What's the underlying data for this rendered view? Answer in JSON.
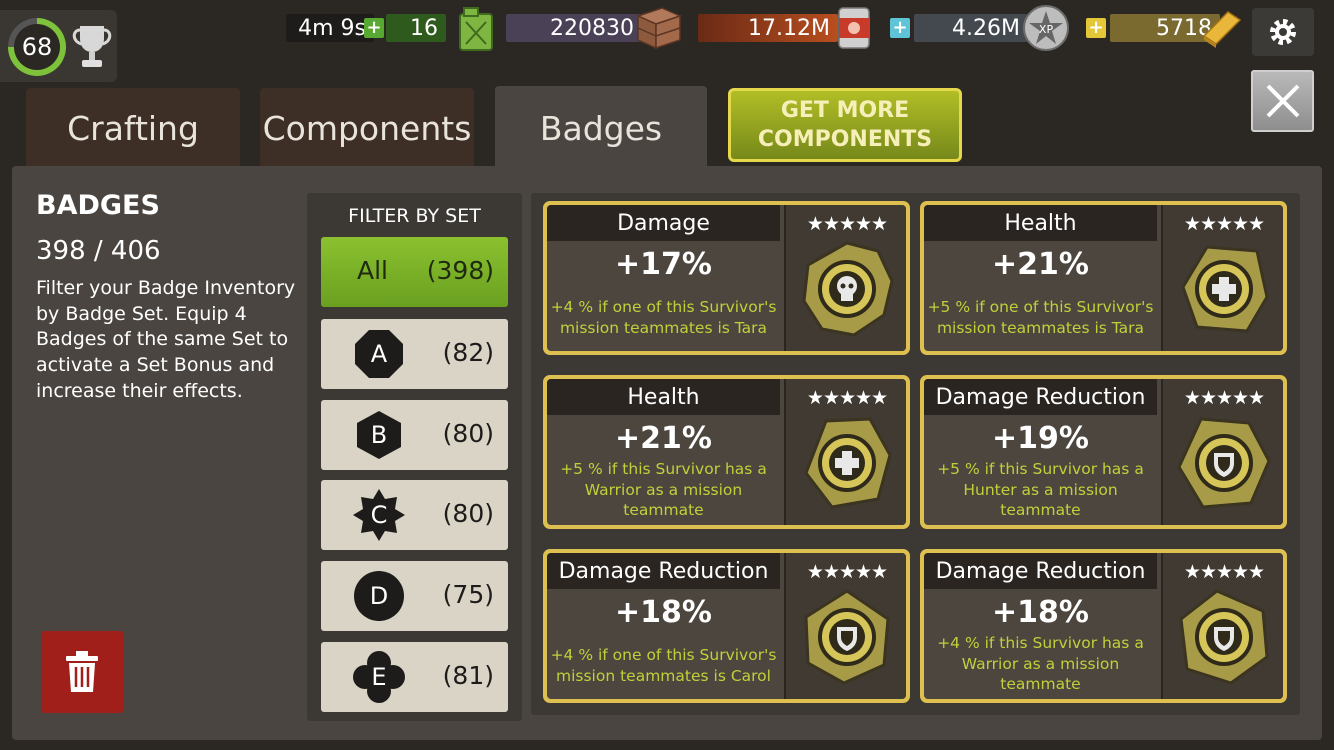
{
  "player": {
    "level": "68"
  },
  "resources": {
    "timer": "4m 9s",
    "fuel": "16",
    "supplies": "220830",
    "food": "17.12M",
    "xp": "4.26M",
    "gold": "5718"
  },
  "tabs": [
    {
      "label": "Crafting"
    },
    {
      "label": "Components"
    },
    {
      "label": "Badges"
    }
  ],
  "get_more": {
    "line1": "GET MORE",
    "line2": "COMPONENTS"
  },
  "info": {
    "title": "BADGES",
    "count": "398 / 406",
    "description": "Filter your Badge Inventory by Badge Set. Equip 4 Badges of the same Set to activate a Set Bonus and increase their effects."
  },
  "filter": {
    "title": "FILTER BY SET",
    "items": [
      {
        "label": "All",
        "count": "(398)"
      },
      {
        "label": "A",
        "count": "(82)"
      },
      {
        "label": "B",
        "count": "(80)"
      },
      {
        "label": "C",
        "count": "(80)"
      },
      {
        "label": "D",
        "count": "(75)"
      },
      {
        "label": "E",
        "count": "(81)"
      }
    ]
  },
  "badges": [
    {
      "stat": "Damage",
      "value": "+17%",
      "bonus": "+4 % if one of this Survivor's mission teammates is Tara",
      "stars": "★★★★★",
      "icon": "skull-badge-icon"
    },
    {
      "stat": "Health",
      "value": "+21%",
      "bonus": "+5 % if one of this Survivor's mission teammates is Tara",
      "stars": "★★★★★",
      "icon": "cross-badge-icon"
    },
    {
      "stat": "Health",
      "value": "+21%",
      "bonus": "+5 % if this Survivor has a Warrior as a mission teammate",
      "stars": "★★★★★",
      "icon": "cross-badge-icon"
    },
    {
      "stat": "Damage Reduction",
      "value": "+19%",
      "bonus": "+5 % if this Survivor has a Hunter as a mission teammate",
      "stars": "★★★★★",
      "icon": "shield-badge-icon"
    },
    {
      "stat": "Damage Reduction",
      "value": "+18%",
      "bonus": "+4 % if one of this Survivor's mission teammates is Carol",
      "stars": "★★★★★",
      "icon": "shield-badge-icon"
    },
    {
      "stat": "Damage Reduction",
      "value": "+18%",
      "bonus": "+4 % if this Survivor has a Warrior as a mission teammate",
      "stars": "★★★★★",
      "icon": "shield-badge-icon"
    }
  ],
  "colors": {
    "accent_gold": "#ddc050",
    "bonus_text": "#bfd13a",
    "active_filter": "#7fb52a",
    "trash": "#a01f1b"
  }
}
